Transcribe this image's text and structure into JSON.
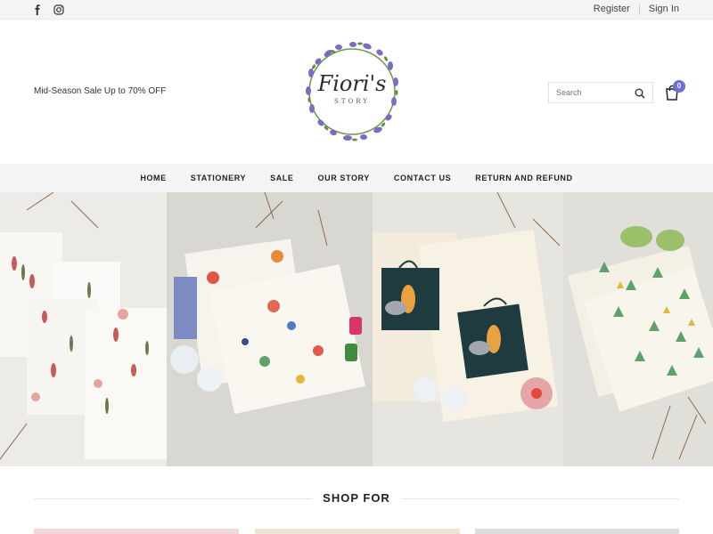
{
  "topbar": {
    "social": [
      "facebook-icon",
      "instagram-icon"
    ],
    "register_label": "Register",
    "signin_label": "Sign In"
  },
  "header": {
    "promo_text": "Mid-Season Sale Up to 70% OFF",
    "logo_text": "Fiori's",
    "logo_subtext": "STORY",
    "search_placeholder": "Search",
    "cart_count": "0"
  },
  "nav": {
    "items": [
      "HOME",
      "STATIONERY",
      "SALE",
      "OUR STORY",
      "CONTACT US",
      "RETURN AND REFUND"
    ]
  },
  "hero": {
    "panels": [
      "floral-stickers-photo",
      "birthday-cards-planets-photo",
      "giraffe-gift-cards-photo",
      "party-hat-cards-photo"
    ]
  },
  "section": {
    "shop_for_title": "SHOP FOR"
  },
  "colors": {
    "accent": "#6b6fd6",
    "topbar_bg": "#f4f4f4",
    "nav_bg": "#f5f5f5"
  }
}
